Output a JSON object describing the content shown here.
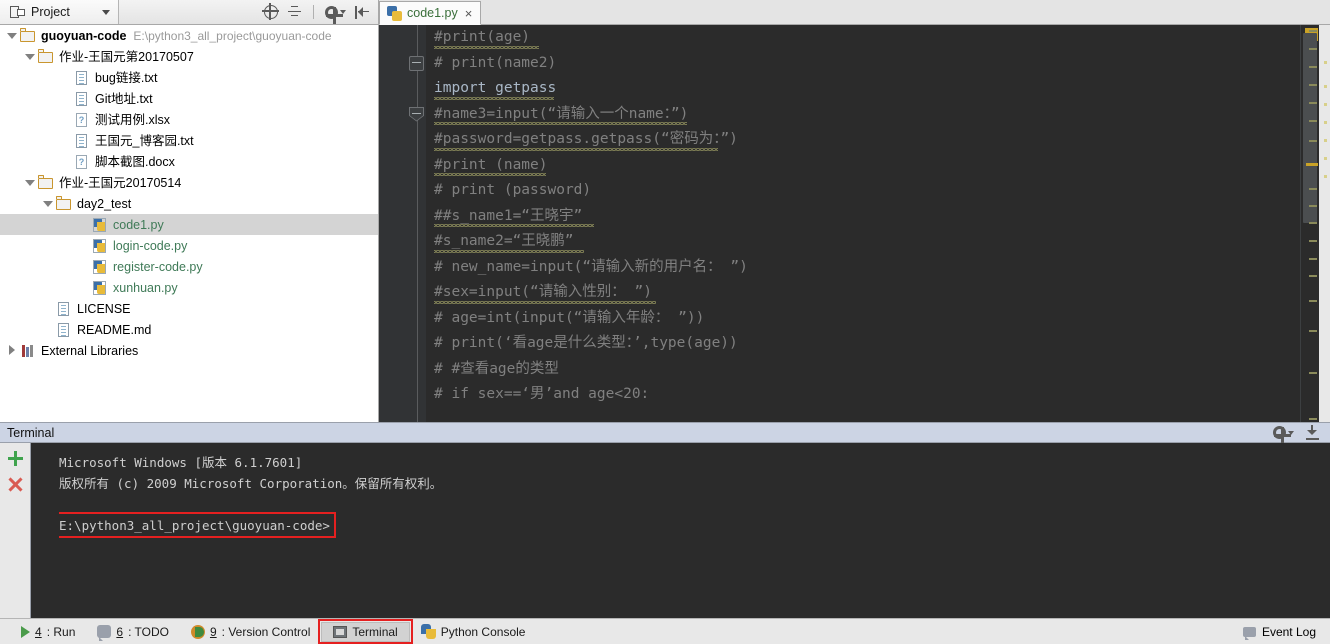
{
  "window": {
    "project_tab_label": "Project",
    "editor_tab": {
      "name": "code1.py",
      "close": "×",
      "icon": "python-file-icon"
    }
  },
  "toolbar": {
    "locate_icon": "crosshair-target-icon",
    "collapse_icon": "collapse-all-icon",
    "settings_icon": "gear-icon",
    "hide_icon": "hide-panel-icon"
  },
  "project_tree": {
    "items": [
      {
        "depth": 1,
        "arrow": "down",
        "icon": "folder-icon",
        "label": "guoyuan-code",
        "bold": true,
        "path": "E:\\python3_all_project\\guoyuan-code",
        "selected": false
      },
      {
        "depth": 2,
        "arrow": "down",
        "icon": "folder-icon",
        "label": "作业-王国元第20170507",
        "bold": false,
        "path": "",
        "selected": false
      },
      {
        "depth": 4,
        "arrow": "none",
        "icon": "text-file-icon",
        "label": "bug链接.txt",
        "bold": false,
        "path": "",
        "selected": false
      },
      {
        "depth": 4,
        "arrow": "none",
        "icon": "text-file-icon",
        "label": "Git地址.txt",
        "bold": false,
        "path": "",
        "selected": false
      },
      {
        "depth": 4,
        "arrow": "none",
        "icon": "unknown-file-icon",
        "label": "测试用例.xlsx",
        "bold": false,
        "path": "",
        "selected": false
      },
      {
        "depth": 4,
        "arrow": "none",
        "icon": "text-file-icon",
        "label": "王国元_博客园.txt",
        "bold": false,
        "path": "",
        "selected": false
      },
      {
        "depth": 4,
        "arrow": "none",
        "icon": "unknown-file-icon",
        "label": "脚本截图.docx",
        "bold": false,
        "path": "",
        "selected": false
      },
      {
        "depth": 2,
        "arrow": "down",
        "icon": "folder-icon",
        "label": "作业-王国元20170514",
        "bold": false,
        "path": "",
        "selected": false
      },
      {
        "depth": 3,
        "arrow": "down",
        "icon": "folder-icon",
        "label": "day2_test",
        "bold": false,
        "path": "",
        "selected": false
      },
      {
        "depth": 5,
        "arrow": "none",
        "icon": "python-file-icon",
        "label": "code1.py",
        "bold": false,
        "path": "",
        "selected": true
      },
      {
        "depth": 5,
        "arrow": "none",
        "icon": "python-file-icon",
        "label": "login-code.py",
        "bold": false,
        "path": "",
        "selected": false
      },
      {
        "depth": 5,
        "arrow": "none",
        "icon": "python-file-icon",
        "label": "register-code.py",
        "bold": false,
        "path": "",
        "selected": false
      },
      {
        "depth": 5,
        "arrow": "none",
        "icon": "python-file-icon",
        "label": "xunhuan.py",
        "bold": false,
        "path": "",
        "selected": false
      },
      {
        "depth": 3,
        "arrow": "none",
        "icon": "text-file-icon",
        "label": "LICENSE",
        "bold": false,
        "path": "",
        "selected": false
      },
      {
        "depth": 3,
        "arrow": "none",
        "icon": "text-file-icon",
        "label": "README.md",
        "bold": false,
        "path": "",
        "selected": false
      },
      {
        "depth": 1,
        "arrow": "right",
        "icon": "library-icon",
        "label": "External Libraries",
        "bold": false,
        "path": "",
        "selected": false
      }
    ]
  },
  "editor": {
    "lines": [
      {
        "text": "#print(age)",
        "wavy": 105,
        "keyword": false,
        "fold": ""
      },
      {
        "text": "# print(name2)",
        "wavy": 0,
        "keyword": false,
        "fold": "square"
      },
      {
        "text": "import getpass",
        "wavy": 120,
        "keyword": true,
        "fold": ""
      },
      {
        "text": "#name3=input(“请输入一个name：”)",
        "wavy": 253,
        "keyword": false,
        "fold": "point"
      },
      {
        "text": "#password=getpass.getpass(“密码为：”)",
        "wavy": 284,
        "keyword": false,
        "fold": ""
      },
      {
        "text": "#print (name)",
        "wavy": 112,
        "keyword": false,
        "fold": ""
      },
      {
        "text": "# print (password)",
        "wavy": 0,
        "keyword": false,
        "fold": ""
      },
      {
        "text": "##s_name1=“王晓宇”",
        "wavy": 160,
        "keyword": false,
        "fold": ""
      },
      {
        "text": "#s_name2=“王晓鹏”",
        "wavy": 150,
        "keyword": false,
        "fold": ""
      },
      {
        "text": "# new_name=input(“请输入新的用户名： ”)",
        "wavy": 0,
        "keyword": false,
        "fold": ""
      },
      {
        "text": "#sex=input(“请输入性别： ”)",
        "wavy": 222,
        "keyword": false,
        "fold": ""
      },
      {
        "text": "# age=int(input(“请输入年龄： ”))",
        "wavy": 0,
        "keyword": false,
        "fold": ""
      },
      {
        "text": "# print(‘看age是什么类型：’,type(age))",
        "wavy": 0,
        "keyword": false,
        "fold": ""
      },
      {
        "text": "# #查看age的类型",
        "wavy": 0,
        "keyword": false,
        "fold": ""
      },
      {
        "text": "# if sex==‘男’and age<20:",
        "wavy": 0,
        "keyword": false,
        "fold": ""
      }
    ]
  },
  "terminal": {
    "title": "Terminal",
    "new_session_icon": "plus-icon",
    "close_session_icon": "close-x-icon",
    "settings_icon": "gear-icon",
    "hide_icon": "hide-panel-icon",
    "lines": [
      "Microsoft Windows [版本 6.1.7601]",
      "版权所有 (c) 2009 Microsoft Corporation。保留所有权利。"
    ],
    "prompt": "E:\\python3_all_project\\guoyuan-code>",
    "highlight_color": "#e52020"
  },
  "status_bar": {
    "buttons": [
      {
        "num": "4",
        "label": ": Run",
        "icon": "run-icon",
        "active": false,
        "highlighted": false
      },
      {
        "num": "6",
        "label": ": TODO",
        "icon": "todo-icon",
        "active": false,
        "highlighted": false
      },
      {
        "num": "9",
        "label": ": Version Control",
        "icon": "version-control-icon",
        "active": false,
        "highlighted": false
      },
      {
        "num": "",
        "label": "Terminal",
        "icon": "terminal-icon",
        "active": true,
        "highlighted": true
      },
      {
        "num": "",
        "label": "Python Console",
        "icon": "python-console-icon",
        "active": false,
        "highlighted": false
      }
    ],
    "event_log": "Event Log",
    "event_log_icon": "event-log-icon"
  }
}
